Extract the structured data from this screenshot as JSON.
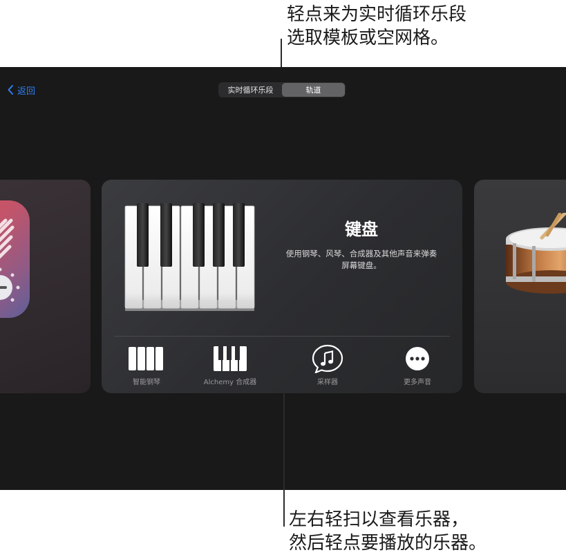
{
  "callouts": {
    "top_line1": "轻点来为实时循环乐段",
    "top_line2": "选取模板或空网格。",
    "bottom_line1": "左右轻扫以查看乐器，",
    "bottom_line2": "然后轻点要播放的乐器。"
  },
  "nav": {
    "back_label": "返回",
    "segments": [
      {
        "label": "实时循环乐段",
        "selected": false
      },
      {
        "label": "轨道",
        "selected": true
      }
    ]
  },
  "instrument_card": {
    "title": "键盘",
    "description_line1": "使用钢琴、风琴、合成器及其他声音来弹奏",
    "description_line2": "屏幕键盘。",
    "options": [
      {
        "label": "智能钢琴",
        "icon": "smart-piano-icon"
      },
      {
        "label": "Alchemy 合成器",
        "icon": "alchemy-synth-icon"
      },
      {
        "label": "采样器",
        "icon": "sampler-icon"
      },
      {
        "label": "更多声音",
        "icon": "more-sounds-icon"
      }
    ]
  },
  "colors": {
    "screen_bg": "#191919",
    "accent_blue": "#2f7ff5",
    "card_bg": "#333436",
    "segment_active": "#636366"
  }
}
